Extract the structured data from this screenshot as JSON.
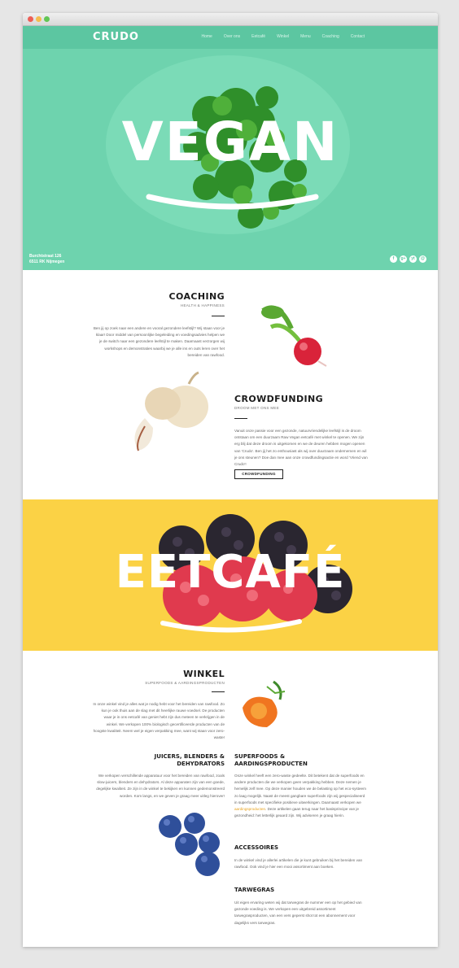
{
  "brand": {
    "logo": "CRUDO"
  },
  "nav": {
    "items": [
      "Home",
      "Over ons",
      "Eetcafé",
      "Winkel",
      "Menu",
      "Coaching",
      "Contact"
    ]
  },
  "hero": {
    "title": "VEGAN",
    "address_line1": "Burchtstraat 126",
    "address_line2": "6511 RK Nijmegen",
    "socials": [
      "f",
      "g+",
      "yt",
      "@"
    ]
  },
  "coaching": {
    "title": "COACHING",
    "subtitle": "HEALTH & HAPPINESS",
    "body": "Ben jij op zoek naar een andere en vooral gezondere leefstijl? Wij staan voor je klaar! Door middel van persoonlijke begeleiding en voedingsadvies helpen we je de switch naar een gezondere leefstijl te maken. Daarnaast verzorgen wij workshops en demonstraties waarbij we je alle ins en outs leren over het bereiden van rawfood."
  },
  "crowdfunding": {
    "title": "CROWDFUNDING",
    "subtitle": "DROOM MET ONS MEE",
    "body": "Vanuit onze passie voor een gezonde, natuurvriendelijke leefstijl is de droom ontstaan om een duurzaam Raw Vegan eetcafé met winkel te openen. We zijn erg blij dat deze droom is uitgekomen en we de deuren hebben mogen openen van 'Crudo'. Ben jij het zo enthousiast als wij over duurzaam ondernemen en wil je ons steunen? Doe dan mee aan onze crowdfundingsactie en word 'Vriend van Crudo'!",
    "button": "CROWDFUNDING"
  },
  "eetcafe": {
    "title": "EETCAFÉ"
  },
  "winkel": {
    "title": "WINKEL",
    "subtitle": "SUPERFOODS & AARDINGSPRODUCTEN",
    "body": "In onze winkel vind je alles wat je nodig hebt voor het bereiden van rawfood. Zo kun je ook thuis aan de slag met dit heerlijke rauwe voedsel. De producten waar je in ons eetcafé van geniet hebt zijn dus meteen te verkrijgen in de winkel. We verkopen 100% biologisch gecertificeerde producten van de hoogste kwaliteit. Neem wel je eigen verpakking mee, want wij staan voor zero-waste!"
  },
  "juicers": {
    "title_line1": "JUICERS, BLENDERS &",
    "title_line2": "DEHYDRATORS",
    "body": "We verkopen verschillende apparatuur voor het bereiden van rawfood, zoals slow-juicers, blenders en dehydrators. Al deze apparaten zijn van een goede, degelijke kwaliteit. Ze zijn in de winkel te bekijken en kunnen gedemonstreerd worden. Kom langs, en we geven je graag meer uitleg hierover!"
  },
  "superfoods": {
    "title_line1": "SUPERFOODS &",
    "title_line2": "AARDINGSPRODUCTEN",
    "body": "Onze winkel heeft een zero-waste gedeelte. Dit betekent dat de superfoods en andere producten die we verkopen geen verpakking hebben. Deze nemen je hemelijk zelf mee. Op deze manier houden we de belasting op het eco-systeem zo laag mogelijk. Naast de meest gangbare superfoods zijn wij gespecialiseerd in superfoods met specifieke positieve uitwerkingen. Daarnaast verkopen we",
    "link": "aardingsproducten",
    "body_after": ". Deze artikelen gaan terug naar het basisprincipe van je gezondheid: het letterlijk geaard zijn. Wij adviseren je graag hierin."
  },
  "accessoires": {
    "title": "ACCESSOIRES",
    "body": "In de winkel vind je allerlei artikelen die je kunt gebruiken bij het bereiden van rawfood. Ook vind je hier een mooi assortiment aan boeken."
  },
  "tarwegras": {
    "title": "TARWEGRAS",
    "body": "Uit eigen ervaring weten wij dat tarwegras de nummer een op het gebied van gezonde voeding is. We verkopen een uitgebreid assortiment tarwegrasproducten, van een vers geperst shot tot een abonnement voor dagelijks vers tarwegras."
  },
  "colors": {
    "mint": "#6ed3ae",
    "mint_dark": "#5cc6a1",
    "yellow": "#fbd245",
    "link": "#e8a21c"
  }
}
